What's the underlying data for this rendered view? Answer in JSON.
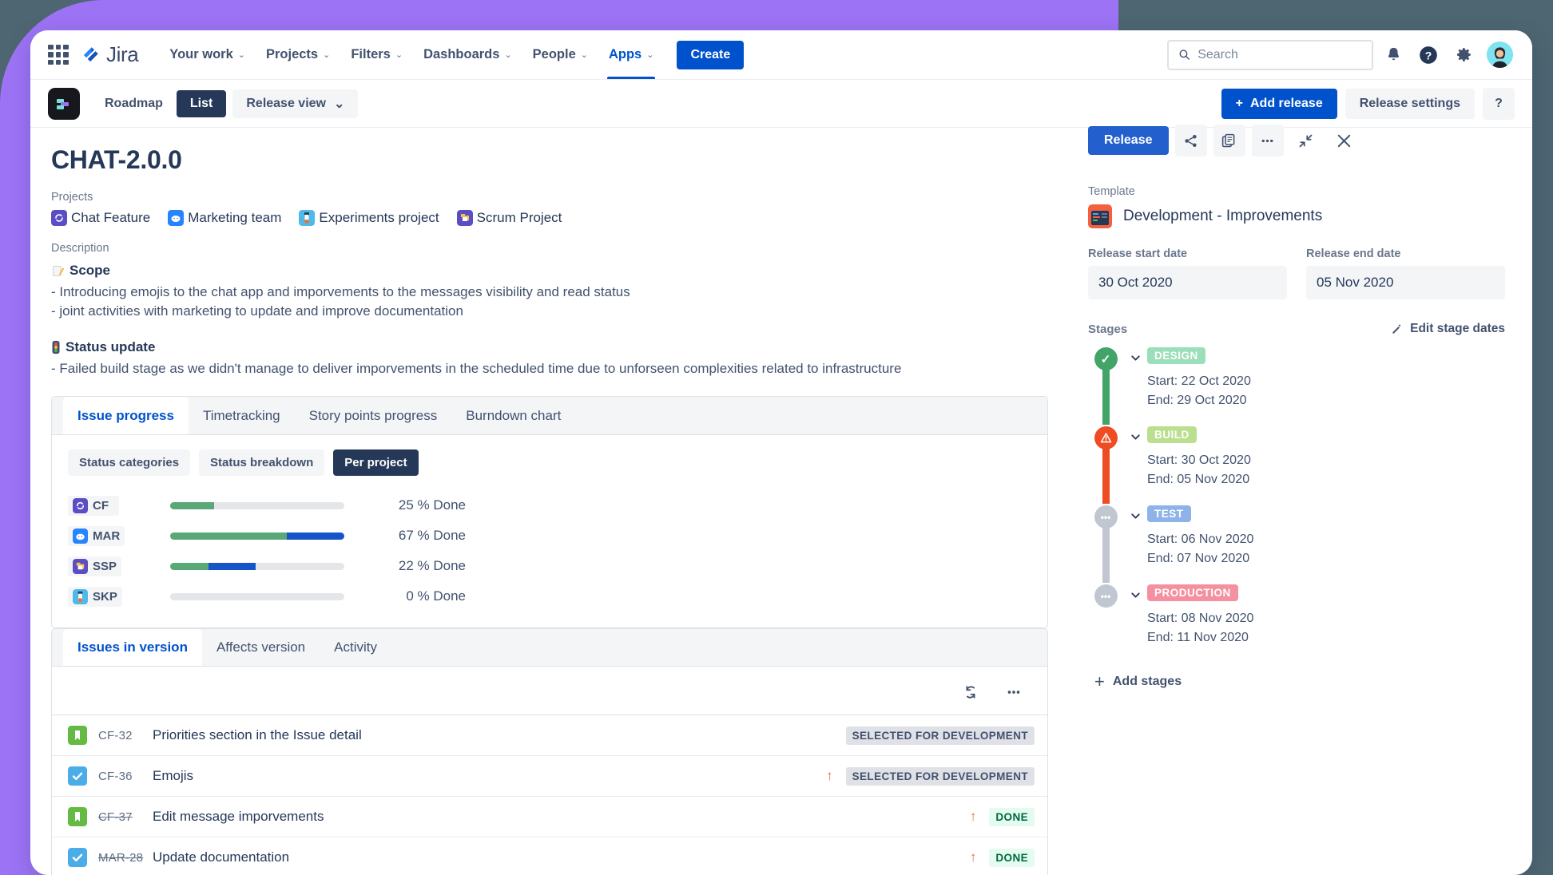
{
  "topnav": {
    "logo_text": "Jira",
    "items": [
      {
        "label": "Your work",
        "caret": "⌄",
        "active": false
      },
      {
        "label": "Projects",
        "caret": "⌄",
        "active": false
      },
      {
        "label": "Filters",
        "caret": "⌄",
        "active": false
      },
      {
        "label": "Dashboards",
        "caret": "⌄",
        "active": false
      },
      {
        "label": "People",
        "caret": "⌄",
        "active": false
      },
      {
        "label": "Apps",
        "caret": "⌄",
        "active": true
      }
    ],
    "create_label": "Create",
    "search_placeholder": "Search",
    "search_value": ""
  },
  "subbar": {
    "roadmap_label": "Roadmap",
    "list_label": "List",
    "release_view_label": "Release view",
    "release_view_caret": "⌄",
    "add_release_label": "Add release",
    "add_release_plus": "+",
    "release_settings_label": "Release settings",
    "help_label": "?"
  },
  "release": {
    "title": "CHAT-2.0.0",
    "release_button": "Release",
    "projects_label": "Projects",
    "projects": [
      {
        "name": "Chat Feature",
        "color": "#5b4ec4"
      },
      {
        "name": "Marketing team",
        "color": "#2684ff"
      },
      {
        "name": "Experiments project",
        "color": "#4fb9e8"
      },
      {
        "name": "Scrum Project",
        "color": "#5b4ec4"
      }
    ],
    "description_label": "Description",
    "description_blocks": [
      {
        "icon": "memo-icon",
        "heading": "Scope",
        "lines": [
          "- Introducing emojis to the chat app and imporvements to the messages visibility and read status",
          "- joint activities with marketing to update and improve documentation"
        ]
      },
      {
        "icon": "traffic-light-icon",
        "heading": "Status update",
        "lines": [
          "- Failed build stage as we didn't manage to deliver imporvements in the scheduled time due to unforseen complexities related to infrastructure"
        ]
      }
    ]
  },
  "progress_card": {
    "tabs": [
      {
        "label": "Issue progress",
        "active": true
      },
      {
        "label": "Timetracking",
        "active": false
      },
      {
        "label": "Story points progress",
        "active": false
      },
      {
        "label": "Burndown chart",
        "active": false
      }
    ],
    "pills": [
      {
        "label": "Status categories",
        "active": false
      },
      {
        "label": "Status breakdown",
        "active": false
      },
      {
        "label": "Per project",
        "active": true
      }
    ]
  },
  "chart_data": {
    "type": "bar",
    "title": "Issue progress — Per project",
    "categories": [
      "CF",
      "MAR",
      "SSP",
      "SKP"
    ],
    "series": [
      {
        "name": "Done",
        "color": "#5aa777",
        "values": [
          25,
          67,
          22,
          0
        ]
      },
      {
        "name": "In progress",
        "color": "#1655c9",
        "values": [
          0,
          33,
          27,
          0
        ]
      }
    ],
    "labels": [
      "25 % Done",
      "67 % Done",
      "22 % Done",
      "0 % Done"
    ],
    "xlabel": "",
    "ylabel": "",
    "ylim": [
      0,
      100
    ],
    "grid": false,
    "legend_position": "none"
  },
  "project_rows": [
    {
      "key": "CF",
      "icon_color": "#5b4ec4",
      "done": 25,
      "progress": 0,
      "text": "25 % Done"
    },
    {
      "key": "MAR",
      "icon_color": "#2684ff",
      "done": 67,
      "progress": 33,
      "text": "67 % Done"
    },
    {
      "key": "SSP",
      "icon_color": "#5b4ec4",
      "done": 22,
      "progress": 27,
      "text": "22 % Done"
    },
    {
      "key": "SKP",
      "icon_color": "#4fb9e8",
      "done": 0,
      "progress": 0,
      "text": "0 % Done"
    }
  ],
  "issues_card": {
    "tabs": [
      {
        "label": "Issues in version",
        "active": true
      },
      {
        "label": "Affects version",
        "active": false
      },
      {
        "label": "Activity",
        "active": false
      }
    ],
    "rows": [
      {
        "type": "story",
        "key": "CF-32",
        "struck": false,
        "summary": "Priorities section in the Issue detail",
        "arrow": false,
        "badge": "SELECTED FOR DEVELOPMENT",
        "badge_kind": "sfd"
      },
      {
        "type": "task",
        "key": "CF-36",
        "struck": false,
        "summary": "Emojis",
        "arrow": true,
        "badge": "SELECTED FOR DEVELOPMENT",
        "badge_kind": "sfd"
      },
      {
        "type": "story",
        "key": "CF-37",
        "struck": true,
        "summary": "Edit message imporvements",
        "arrow": true,
        "badge": "DONE",
        "badge_kind": "done"
      },
      {
        "type": "task",
        "key": "MAR-28",
        "struck": true,
        "summary": "Update documentation",
        "arrow": true,
        "badge": "DONE",
        "badge_kind": "done"
      }
    ]
  },
  "sidebar": {
    "template_label": "Template",
    "template_name": "Development - Improvements",
    "start_date_label": "Release start date",
    "start_date_value": "30 Oct 2020",
    "end_date_label": "Release end date",
    "end_date_value": "05 Nov 2020",
    "stages_label": "Stages",
    "edit_stage_dates_label": "Edit stage dates",
    "add_stages_label": "Add stages",
    "add_stages_plus": "+",
    "stages": [
      {
        "name": "DESIGN",
        "tag_color": "#9bdfb8",
        "dot_color": "#43a46a",
        "dot_glyph": "✓",
        "connector_color": "#43a46a",
        "start": "Start: 22 Oct 2020",
        "end": "End: 29 Oct 2020",
        "chevron": "⌄"
      },
      {
        "name": "BUILD",
        "tag_color": "#badf8f",
        "dot_color": "#f04c23",
        "dot_glyph": "!",
        "connector_color": "#f04c23",
        "start": "Start: 30 Oct 2020",
        "end": "End: 05 Nov 2020",
        "chevron": "⌄"
      },
      {
        "name": "TEST",
        "tag_color": "#8fb3e8",
        "dot_color": "#c1c7d0",
        "dot_glyph": "•••",
        "connector_color": "#c1c7d0",
        "start": "Start: 06 Nov 2020",
        "end": "End: 07 Nov 2020",
        "chevron": "⌄"
      },
      {
        "name": "PRODUCTION",
        "tag_color": "#f4909f",
        "dot_color": "#c1c7d0",
        "dot_glyph": "•••",
        "connector_color": "transparent",
        "start": "Start: 08 Nov 2020",
        "end": "End: 11 Nov 2020",
        "chevron": "⌄"
      }
    ]
  }
}
